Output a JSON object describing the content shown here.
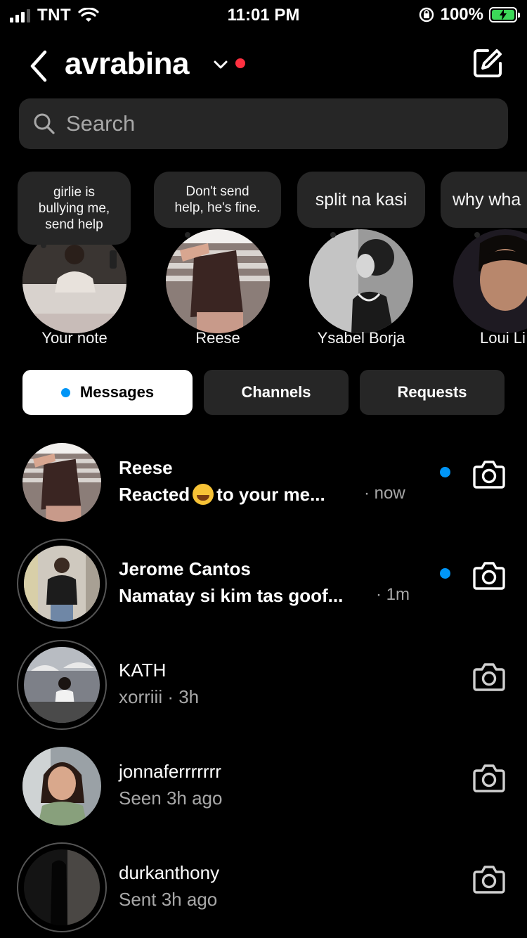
{
  "status_bar": {
    "carrier": "TNT",
    "time": "11:01 PM",
    "battery_percent": "100%",
    "battery_color": "#3cd758"
  },
  "header": {
    "username": "avrabina",
    "back_icon": "chevron-left-icon",
    "dropdown_icon": "chevron-down-icon",
    "notification_dot_color": "#ff3040",
    "compose_icon": "compose-icon"
  },
  "search": {
    "placeholder": "Search"
  },
  "notes": [
    {
      "name": "Your note",
      "note_lines": [
        "girlie is",
        "bullying me,",
        "send help"
      ]
    },
    {
      "name": "Reese",
      "note_lines": [
        "Don't send",
        "help, he's fine."
      ]
    },
    {
      "name": "Ysabel Borja",
      "note_lines": [
        "split na kasi"
      ]
    },
    {
      "name": "Loui Li",
      "note_lines": [
        "why wha"
      ]
    }
  ],
  "tabs": [
    {
      "label": "Messages",
      "active": true
    },
    {
      "label": "Channels",
      "active": false
    },
    {
      "label": "Requests",
      "active": false
    }
  ],
  "conversations": [
    {
      "name": "Reese",
      "preview_before": "Reacted",
      "preview_after": "to your me...",
      "time": "· now",
      "unread": true
    },
    {
      "name": "Jerome Cantos",
      "preview": "Namatay si kim tas goof...",
      "time": "· 1m",
      "unread": true
    },
    {
      "name": "KATH",
      "preview": "xorriii · 3h",
      "unread": false
    },
    {
      "name": "jonnaferrrrrrr",
      "preview": "Seen 3h ago",
      "unread": false
    },
    {
      "name": "durkanthony",
      "preview": "Sent 3h ago",
      "unread": false
    }
  ],
  "colors": {
    "background": "#000000",
    "surface": "#262626",
    "unread_dot": "#0095f6",
    "secondary_text": "#a8a8a8"
  }
}
